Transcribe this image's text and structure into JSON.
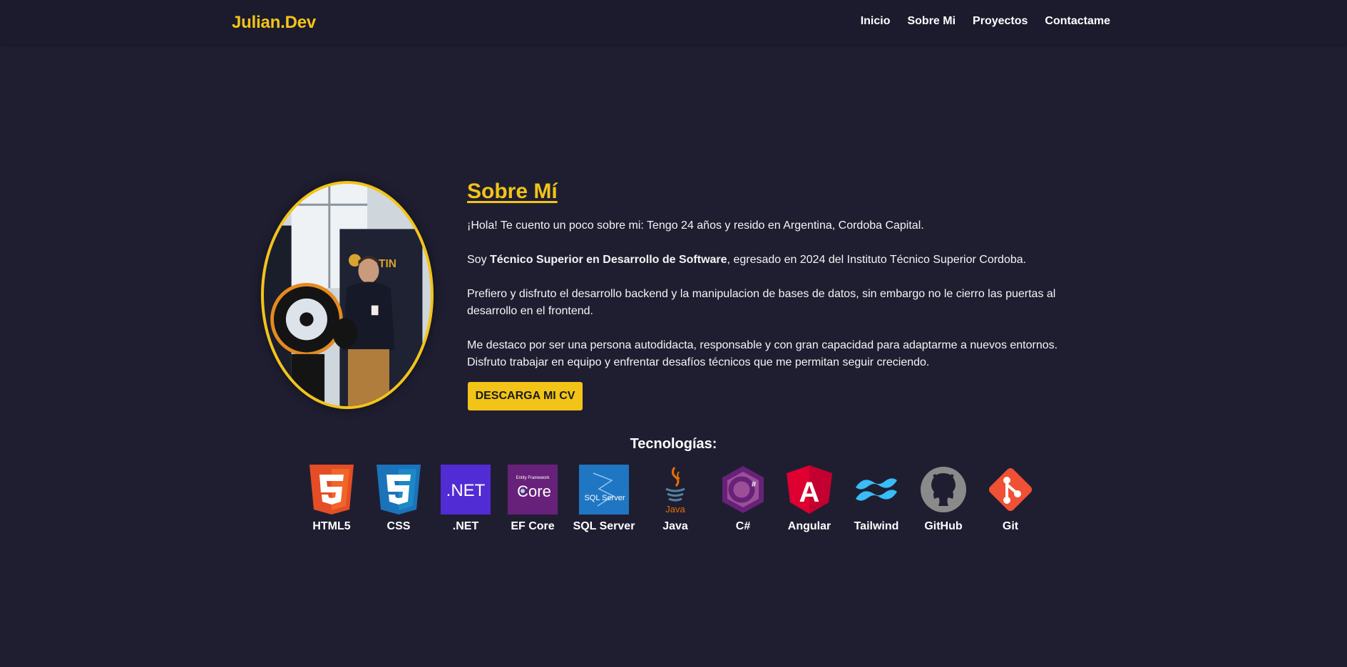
{
  "nav": {
    "brand": "Julian.Dev",
    "links": [
      "Inicio",
      "Sobre Mi",
      "Proyectos",
      "Contactame"
    ]
  },
  "about": {
    "title": "Sobre Mí",
    "p1": "¡Hola! Te cuento un poco sobre mi: Tengo 24 años y resido en Argentina, Cordoba Capital.",
    "p2_pre": "Soy ",
    "p2_bold": "Técnico Superior en Desarrollo de Software",
    "p2_post": ", egresado en 2024 del Instituto Técnico Superior Cordoba.",
    "p3": "Prefiero y disfruto el desarrollo backend y la manipulacion de bases de datos, sin embargo no le cierro las puertas al desarrollo en el frontend.",
    "p4": "Me destaco por ser una persona autodidacta, responsable y con gran capacidad para adaptarme a nuevos entornos. Disfruto trabajar en equipo y enfrentar desafíos técnicos que me permitan seguir creciendo.",
    "cv_button": "DESCARGA MI CV",
    "photo_icon": "profile-photo"
  },
  "tech": {
    "title": "Tecnologías:",
    "items": [
      {
        "label": "HTML5",
        "icon": "html5-icon",
        "color": "#e44d26"
      },
      {
        "label": "CSS",
        "icon": "css3-icon",
        "color": "#1b73ba"
      },
      {
        "label": ".NET",
        "icon": "dotnet-icon",
        "color": "#512bd4",
        "text": ".NET"
      },
      {
        "label": "EF Core",
        "icon": "ef-core-icon",
        "color": "#68217a",
        "text": "Core",
        "subtext": "Entity Framework"
      },
      {
        "label": "SQL Server",
        "icon": "sql-server-icon",
        "color": "#1f76c2",
        "text": "SQL Server"
      },
      {
        "label": "Java",
        "icon": "java-icon",
        "color": "#e76f00",
        "text": "Java"
      },
      {
        "label": "C#",
        "icon": "csharp-icon",
        "color": "#68217a",
        "text": "C#"
      },
      {
        "label": "Angular",
        "icon": "angular-icon",
        "color": "#dd0031",
        "text": "A"
      },
      {
        "label": "Tailwind",
        "icon": "tailwind-icon",
        "color": "#38bdf8"
      },
      {
        "label": "GitHub",
        "icon": "github-icon",
        "color": "#8a8a8a"
      },
      {
        "label": "Git",
        "icon": "git-icon",
        "color": "#f05033"
      }
    ]
  },
  "colors": {
    "background": "#1f1e31",
    "navbar": "#1c1b2d",
    "accent": "#f2c418",
    "text": "#ffffff"
  }
}
